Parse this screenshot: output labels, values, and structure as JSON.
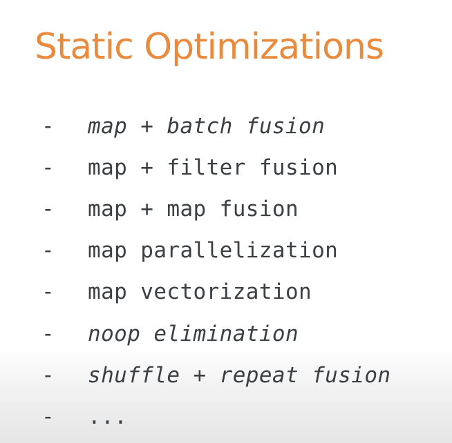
{
  "slide": {
    "title": "Static Optimizations",
    "bullet": "-",
    "items": [
      {
        "text": "map + batch fusion"
      },
      {
        "text": "map + filter fusion"
      },
      {
        "text": "map + map fusion"
      },
      {
        "text": "map parallelization"
      },
      {
        "text": "map vectorization"
      },
      {
        "text": "noop elimination"
      },
      {
        "text": "shuffle + repeat fusion"
      },
      {
        "text": "..."
      }
    ]
  },
  "colors": {
    "title": "#e98b3e",
    "text": "#3c4043",
    "background": "#ffffff"
  }
}
